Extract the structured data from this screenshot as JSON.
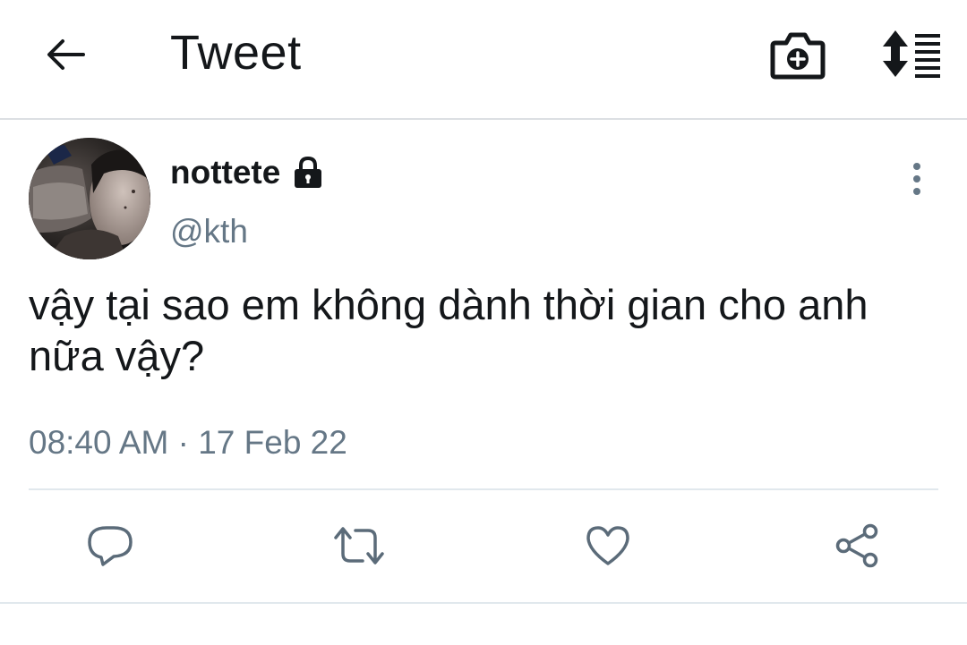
{
  "header": {
    "title": "Tweet",
    "back_icon": "arrow-left-icon",
    "camera_icon": "camera-plus-icon",
    "sort_icon": "sort-list-icon"
  },
  "tweet": {
    "display_name": "nottete",
    "handle": "@kth",
    "protected": true,
    "text": "vậy tại sao em không dành thời gian cho anh nữa vậy?",
    "timestamp": "08:40 AM · 17 Feb 22"
  },
  "actions": [
    {
      "name": "reply",
      "icon": "reply-bubble-icon"
    },
    {
      "name": "retweet",
      "icon": "retweet-icon"
    },
    {
      "name": "like",
      "icon": "heart-icon"
    },
    {
      "name": "share",
      "icon": "share-icon"
    }
  ],
  "colors": {
    "text": "#14171a",
    "secondary": "#657786",
    "icon": "#5b6b79",
    "divider": "#e1e8ed"
  }
}
